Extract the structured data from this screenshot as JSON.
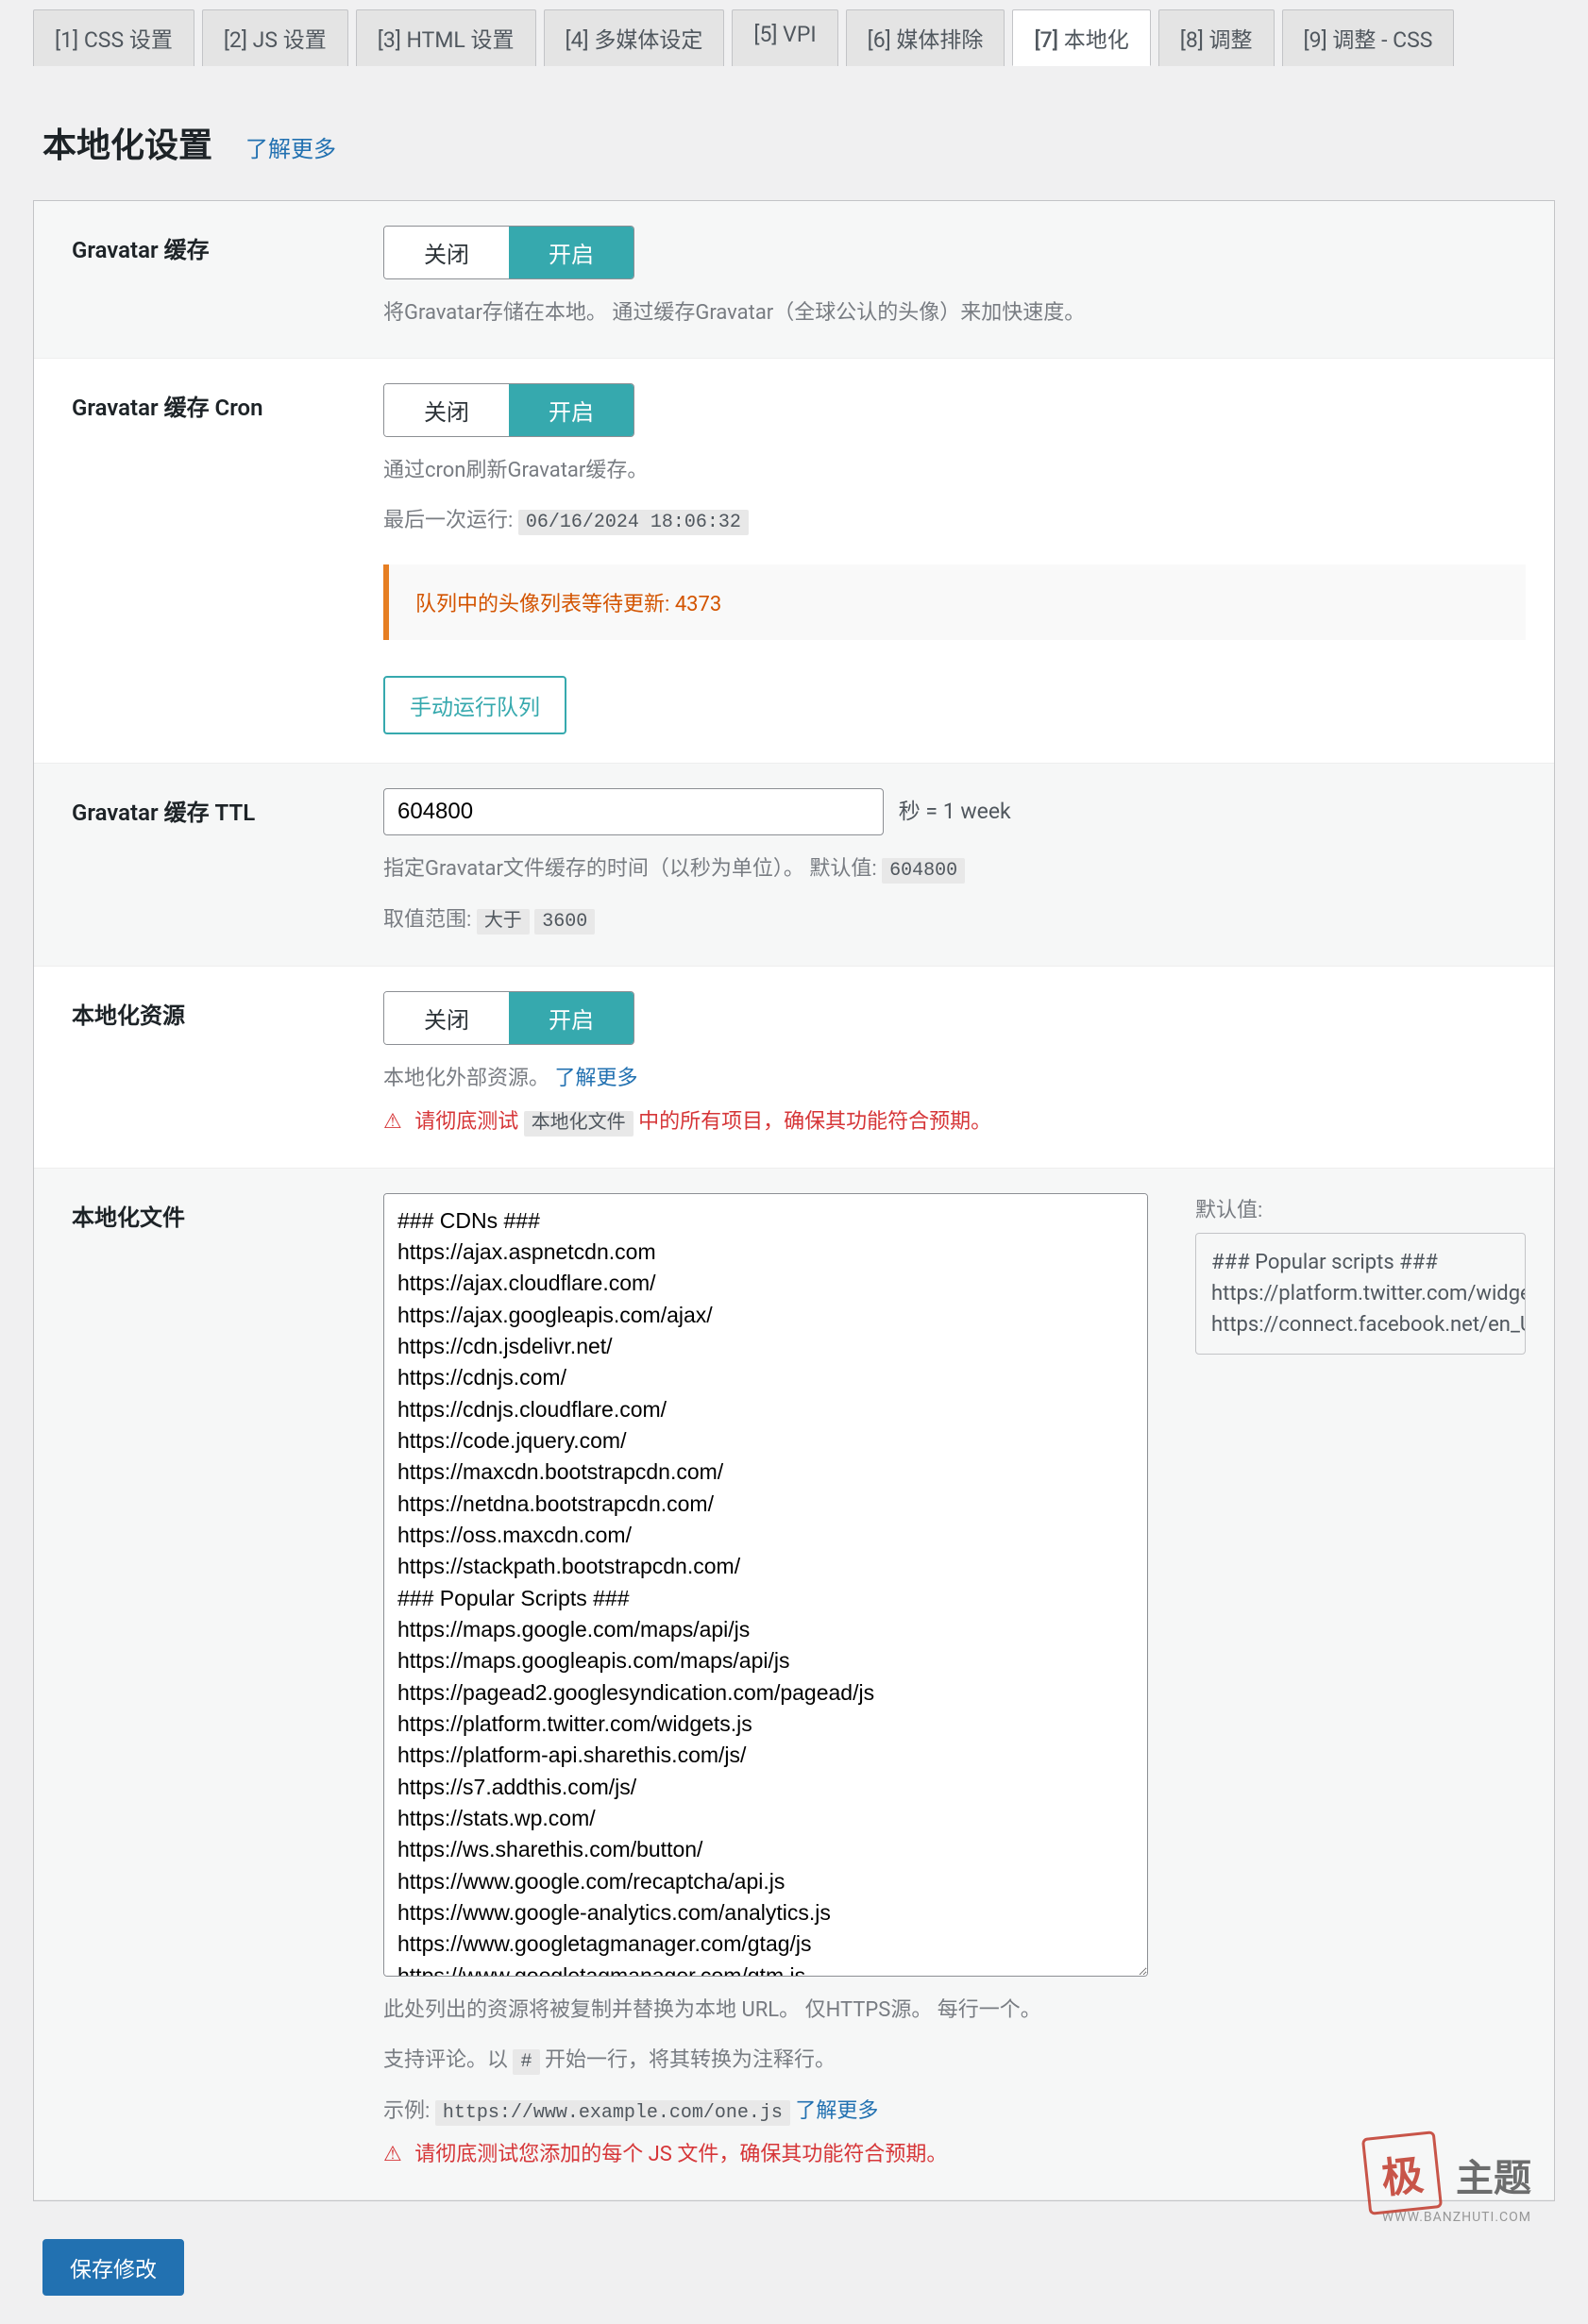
{
  "tabs": [
    {
      "label": "[1] CSS 设置"
    },
    {
      "label": "[2] JS 设置"
    },
    {
      "label": "[3] HTML 设置"
    },
    {
      "label": "[4] 多媒体设定"
    },
    {
      "label": "[5] VPI"
    },
    {
      "label": "[6] 媒体排除"
    },
    {
      "label": "[7] 本地化"
    },
    {
      "label": "[8] 调整"
    },
    {
      "label": "[9] 调整 - CSS"
    }
  ],
  "header": {
    "title": "本地化设置",
    "learn_more": "了解更多"
  },
  "toggle": {
    "off": "关闭",
    "on": "开启"
  },
  "gravatar_cache": {
    "label": "Gravatar 缓存",
    "desc": "将Gravatar存储在本地。 通过缓存Gravatar（全球公认的头像）来加快速度。"
  },
  "gravatar_cron": {
    "label": "Gravatar 缓存 Cron",
    "desc": "通过cron刷新Gravatar缓存。",
    "last_run_label": "最后一次运行:",
    "last_run_value": "06/16/2024 18:06:32",
    "queue_label": "队列中的头像列表等待更新:",
    "queue_count": "4373",
    "manual_btn": "手动运行队列"
  },
  "gravatar_ttl": {
    "label": "Gravatar 缓存 TTL",
    "value": "604800",
    "suffix": "秒 = 1 week",
    "desc_a": "指定Gravatar文件缓存的时间（以秒为单位）。 默认值:",
    "default_value": "604800",
    "range_label": "取值范围:",
    "range_op": "大于",
    "range_min": "3600"
  },
  "local_res": {
    "label": "本地化资源",
    "desc": "本地化外部资源。",
    "learn_more": "了解更多",
    "warn_pre": "请彻底测试",
    "warn_code": "本地化文件",
    "warn_post": "中的所有项目，确保其功能符合预期。"
  },
  "local_files": {
    "label": "本地化文件",
    "content": "### CDNs ###\nhttps://ajax.aspnetcdn.com\nhttps://ajax.cloudflare.com/\nhttps://ajax.googleapis.com/ajax/\nhttps://cdn.jsdelivr.net/\nhttps://cdnjs.com/\nhttps://cdnjs.cloudflare.com/\nhttps://code.jquery.com/\nhttps://maxcdn.bootstrapcdn.com/\nhttps://netdna.bootstrapcdn.com/\nhttps://oss.maxcdn.com/\nhttps://stackpath.bootstrapcdn.com/\n### Popular Scripts ###\nhttps://maps.google.com/maps/api/js\nhttps://maps.googleapis.com/maps/api/js\nhttps://pagead2.googlesyndication.com/pagead/js\nhttps://platform.twitter.com/widgets.js\nhttps://platform-api.sharethis.com/js/\nhttps://s7.addthis.com/js/\nhttps://stats.wp.com/\nhttps://ws.sharethis.com/button/\nhttps://www.google.com/recaptcha/api.js\nhttps://www.google-analytics.com/analytics.js\nhttps://www.googletagmanager.com/gtag/js\nhttps://www.googletagmanager.com/gtm.js\nhttps://www.googletagservices.com/tag/js/gpt.js\nhttps://connect.facebook.net/en_US/fbevents.js\nhttps://connect.facebook.net/signals/config/",
    "default_label": "默认值:",
    "default_content": "### Popular scripts ###\nhttps://platform.twitter.com/widgets.js\nhttps://connect.facebook.net/en_US/fb",
    "desc1": "此处列出的资源将被复制并替换为本地 URL。 仅HTTPS源。 每行一个。",
    "desc2_a": "支持评论。以",
    "desc2_hash": "#",
    "desc2_b": "开始一行，将其转换为注释行。",
    "example_label": "示例:",
    "example_code": "https://www.example.com/one.js",
    "learn_more": "了解更多",
    "warn": "请彻底测试您添加的每个 JS 文件，确保其功能符合预期。"
  },
  "save": "保存修改",
  "watermark": {
    "stamp": "极",
    "text": "主题",
    "sub": "WWW.BANZHUTI.COM"
  }
}
